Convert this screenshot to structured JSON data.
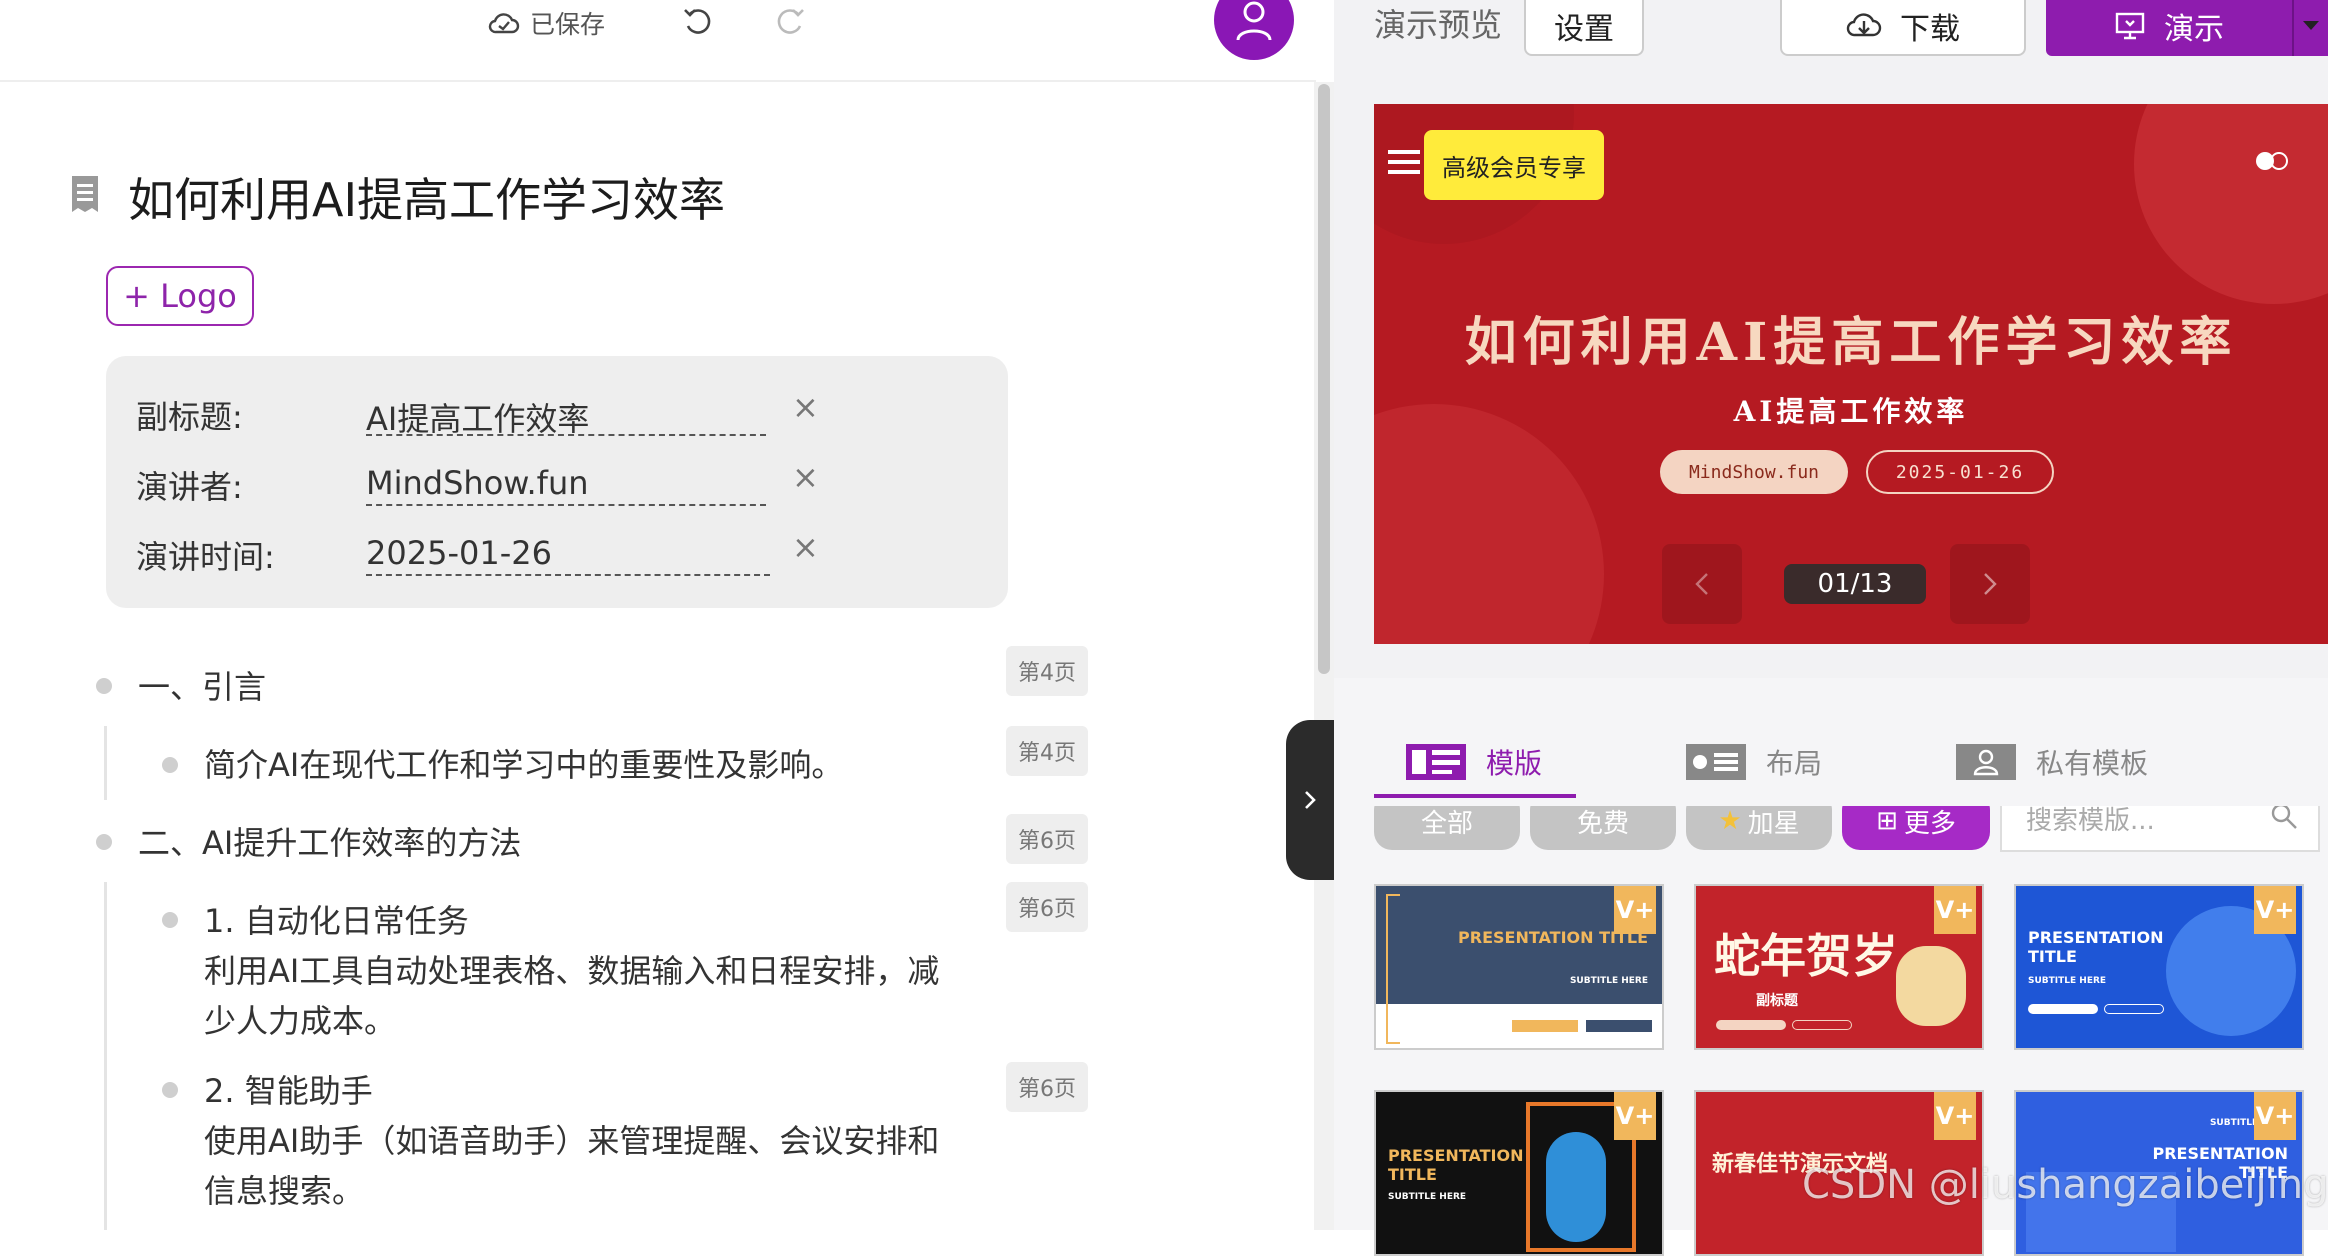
{
  "toolbar": {
    "saved_label": "已保存"
  },
  "document": {
    "title": "如何利用AI提高工作学习效率",
    "logo_button": "+ Logo",
    "meta": [
      {
        "label": "副标题:",
        "value": "AI提高工作效率"
      },
      {
        "label": "演讲者:",
        "value": "MindShow.fun"
      },
      {
        "label": "演讲时间:",
        "value": "2025-01-26"
      }
    ],
    "close_glyph": "×",
    "outline": [
      {
        "text": "一、引言",
        "page": "第4页"
      },
      {
        "text": "简介AI在现代工作和学习中的重要性及影响。",
        "page": "第4页"
      },
      {
        "text": "二、AI提升工作效率的方法",
        "page": "第6页"
      },
      {
        "text": "1. 自动化日常任务",
        "body": [
          "利用AI工具自动处理表格、数据输入和日程安排，减",
          "少人力成本。"
        ],
        "page": "第6页"
      },
      {
        "text": "2. 智能助手",
        "body": [
          "使用AI助手（如语音助手）来管理提醒、会议安排和",
          "信息搜索。"
        ],
        "page": "第6页"
      }
    ]
  },
  "preview": {
    "label": "演示预览",
    "settings_button": "设置",
    "download_button": "下载",
    "present_button": "演示",
    "slide": {
      "vip_badge": "高级会员专享",
      "title": "如何利用AI提高工作学习效率",
      "subtitle": "AI提高工作效率",
      "presenter": "MindShow.fun",
      "date": "2025-01-26",
      "page_counter": "01/13"
    }
  },
  "templates_panel": {
    "tabs": [
      "模版",
      "布局",
      "私有模板"
    ],
    "filters": [
      "全部",
      "免费",
      "加星",
      "更多"
    ],
    "search_placeholder": "搜索模版...",
    "cards": [
      {
        "title": "PRESENTATION TITLE",
        "subtitle": "SUBTITLE HERE"
      },
      {
        "title": "蛇年贺岁",
        "subtitle": "副标题"
      },
      {
        "title": "PRESENTATION TITLE",
        "subtitle": "SUBTITLE HERE"
      },
      {
        "title": "PRESENTATION TITLE",
        "subtitle": "SUBTITLE HERE"
      },
      {
        "title": "新春佳节演示文档",
        "subtitle": ""
      },
      {
        "title": "PRESENTATION TITLE",
        "subtitle": "SUBTITLE HERE"
      }
    ],
    "vip_tag": "V+"
  },
  "watermark": "CSDN @liushangzaibeijing",
  "colors": {
    "accent": "#8e1cae",
    "slide_red": "#b51a22",
    "vip_yellow": "#ffeb3b"
  }
}
